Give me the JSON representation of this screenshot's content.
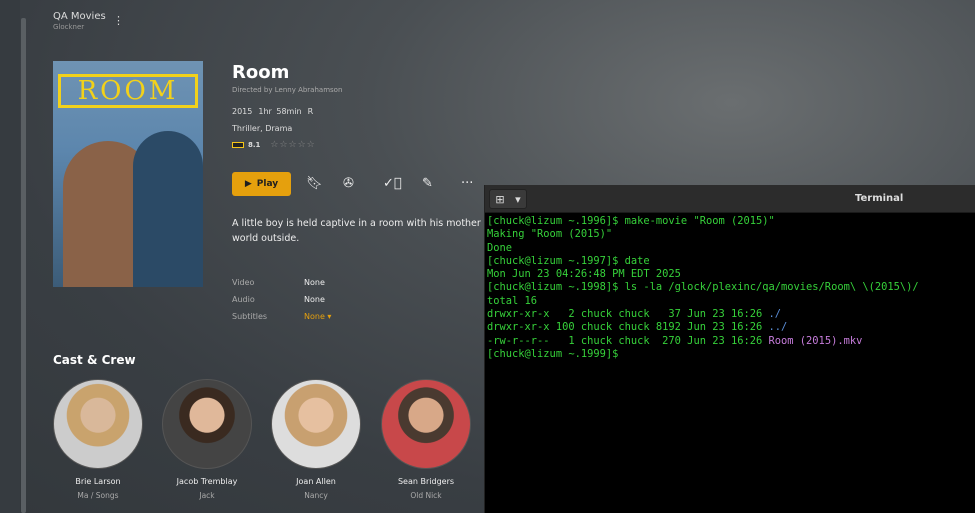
{
  "library": {
    "name": "QA Movies",
    "server": "Glockner"
  },
  "movie": {
    "title": "Room",
    "director": "Directed by Lenny Abrahamson",
    "year": "2015",
    "duration": "1hr 58min",
    "rating": "R",
    "genres": "Thriller, Drama",
    "imdb_score": "8.1",
    "user_stars": 0,
    "poster_text": "ROOM",
    "description": "A little boy is held captive in a room with his mother since",
    "description2": "world outside."
  },
  "actions": {
    "play": "Play",
    "icons": [
      "bookmark-icon",
      "film-reel-icon",
      "check-circle-icon",
      "pencil-icon",
      "more-icon"
    ]
  },
  "streams": [
    {
      "label": "Video",
      "value": "None"
    },
    {
      "label": "Audio",
      "value": "None"
    },
    {
      "label": "Subtitles",
      "value": "None"
    }
  ],
  "cast": {
    "heading": "Cast & Crew",
    "members": [
      {
        "name": "Brie Larson",
        "role": "Ma / Songs"
      },
      {
        "name": "Jacob Tremblay",
        "role": "Jack"
      },
      {
        "name": "Joan Allen",
        "role": "Nancy"
      },
      {
        "name": "Sean Bridgers",
        "role": "Old Nick"
      }
    ]
  },
  "terminal": {
    "title": "Terminal",
    "lines": [
      "[chuck@lizum ~.1996]$ make-movie \"Room (2015)\"",
      "Making \"Room (2015)\"",
      "Done",
      "[chuck@lizum ~.1997]$ date",
      "Mon Jun 23 04:26:48 PM EDT 2025",
      "[chuck@lizum ~.1998]$ ls -la /glock/plexinc/qa/movies/Room\\ \\(2015\\)/",
      "total 16",
      "drwxr-xr-x   2 chuck chuck   37 Jun 23 16:26 ",
      "drwxr-xr-x 100 chuck chuck 8192 Jun 23 16:26 ",
      "-rw-r--r--   1 chuck chuck  270 Jun 23 16:26 ",
      "[chuck@lizum ~.1999]$ "
    ],
    "entries": [
      "./",
      "../",
      "Room (2015).mkv"
    ]
  },
  "colors": {
    "accent": "#e5a00d",
    "terminal_text": "#36d13a",
    "dir": "#5b8fd9",
    "file": "#c77ddc"
  }
}
